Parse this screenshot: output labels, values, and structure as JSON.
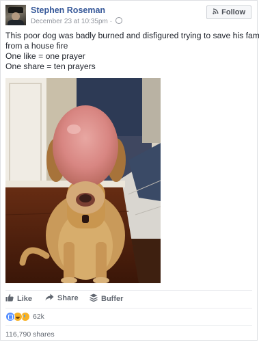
{
  "post": {
    "author": "Stephen Roseman",
    "date": "December 23 at 10:35pm",
    "separator": "·",
    "follow_label": "Follow",
    "text_lines": [
      "This poor dog was badly burned and disfigured trying to save his family",
      "from a house fire",
      "One like = one prayer",
      "One share = ten prayers"
    ],
    "photo_subject": "dog"
  },
  "actions": {
    "like_label": "Like",
    "share_label": "Share",
    "buffer_label": "Buffer"
  },
  "stats": {
    "reaction_count": "62k",
    "reaction_types": [
      "like",
      "haha",
      "sad"
    ],
    "shares_text": "116,790 shares"
  },
  "colors": {
    "link": "#365899",
    "meta": "#90949c",
    "action": "#616770",
    "like_reaction": "#5890ff",
    "emoji_reaction": "#f7b125"
  }
}
